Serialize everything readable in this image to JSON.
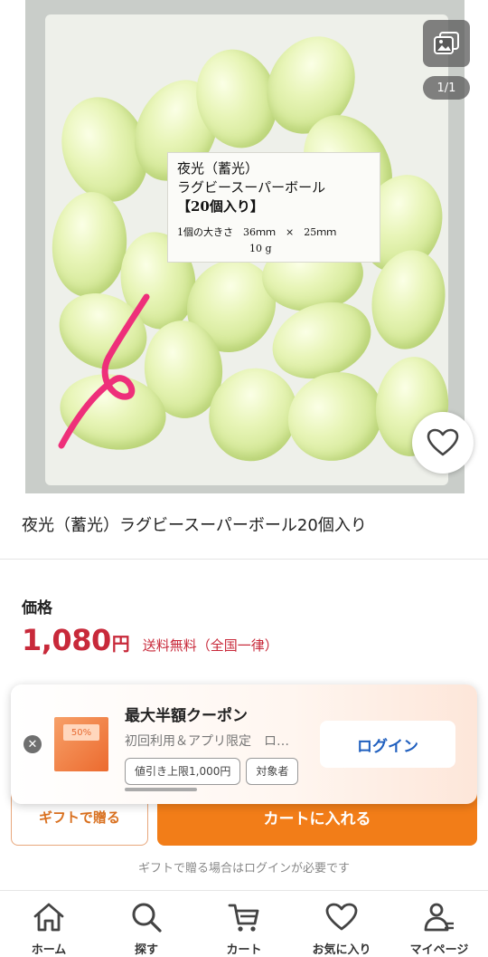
{
  "gallery": {
    "counter": "1/1",
    "image_label": {
      "line1": "夜光（蓄光）",
      "line2": "ラグビースーパーボール",
      "line3": "【20個入り】",
      "line4": "1個の大きさ　36ｍｍ　×　25ｍｍ",
      "line5": "10 g"
    }
  },
  "product": {
    "title": "夜光（蓄光）ラグビースーパーボール20個入り",
    "price_label": "価格",
    "price_value": "1,080",
    "price_unit": "円",
    "shipping": "送料無料",
    "shipping_note": "（全国一律）"
  },
  "coupon": {
    "title": "最大半額クーポン",
    "subtitle": "初回利用＆アプリ限定　ロ…",
    "chips": [
      "値引き上限1,000円",
      "対象者"
    ],
    "image_badge": "50%",
    "login_label": "ログイン"
  },
  "actions": {
    "gift_label": "ギフトで贈る",
    "cart_label": "カートに入れる",
    "gift_note": "ギフトで贈る場合はログインが必要です"
  },
  "tabbar": {
    "items": [
      {
        "label": "ホーム",
        "icon": "home-icon"
      },
      {
        "label": "探す",
        "icon": "search-icon"
      },
      {
        "label": "カート",
        "icon": "cart-icon"
      },
      {
        "label": "お気に入り",
        "icon": "heart-icon"
      },
      {
        "label": "マイページ",
        "icon": "user-icon"
      }
    ]
  },
  "colors": {
    "price": "#c8293a",
    "cta": "#f27d18",
    "login_text": "#1f5fbf"
  }
}
